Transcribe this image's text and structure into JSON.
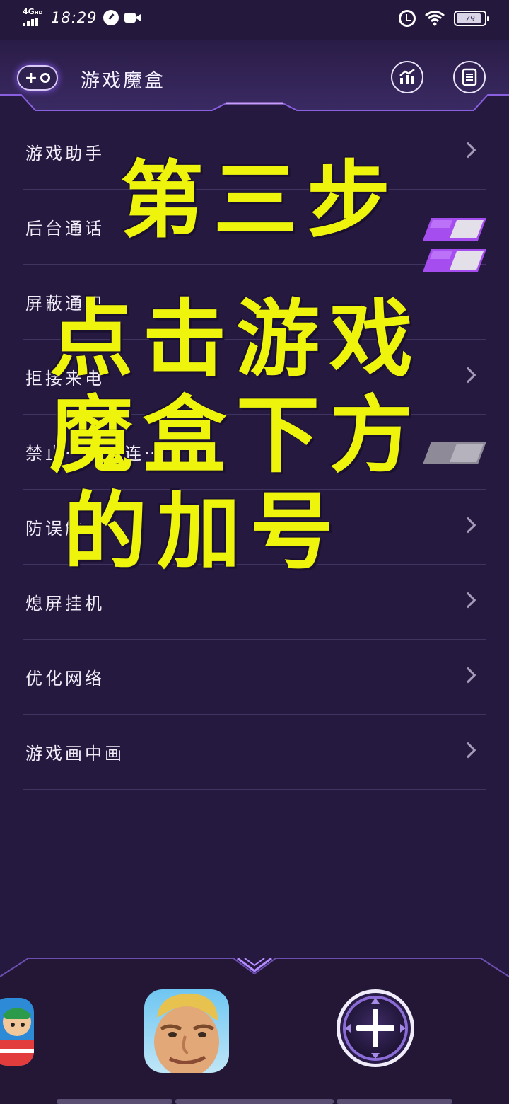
{
  "status_bar": {
    "network": "4G",
    "network_sub": "HD",
    "time": "18:29",
    "battery": "79",
    "icons": [
      "signal-icon",
      "speed-gauge-icon",
      "video-camera-icon",
      "alarm-icon",
      "wifi-icon",
      "battery-icon"
    ]
  },
  "header": {
    "add_button": "+",
    "title": "游戏魔盒",
    "icons": [
      "stats-chart-icon",
      "document-list-icon"
    ]
  },
  "menu": {
    "items": [
      {
        "label": "游戏助手",
        "control": "chevron"
      },
      {
        "label": "后台通话",
        "control": "toggle",
        "toggle_on": true
      },
      {
        "label": "屏蔽通知",
        "control": "toggle",
        "toggle_on": true
      },
      {
        "label": "拒接来电",
        "control": "chevron"
      },
      {
        "label": "禁止⋯自动连⋯",
        "control": "toggle",
        "toggle_on": false
      },
      {
        "label": "防误触",
        "control": "chevron"
      },
      {
        "label": "熄屏挂机",
        "control": "chevron"
      },
      {
        "label": "优化网络",
        "control": "chevron"
      },
      {
        "label": "游戏画中画",
        "control": "chevron"
      }
    ]
  },
  "overlay": {
    "lines": [
      "第三步",
      "点击游戏",
      "魔盒下方",
      "的加号"
    ],
    "color": "#eef40c"
  },
  "dock": {
    "apps": [
      "game-app-icon-left",
      "game-app-icon-face"
    ],
    "add_button": "add-game-icon"
  },
  "colors": {
    "background": "#26193f",
    "accent": "#8b3fe0",
    "toggle_on": "#a64df0",
    "toggle_off": "#9a96a4"
  }
}
